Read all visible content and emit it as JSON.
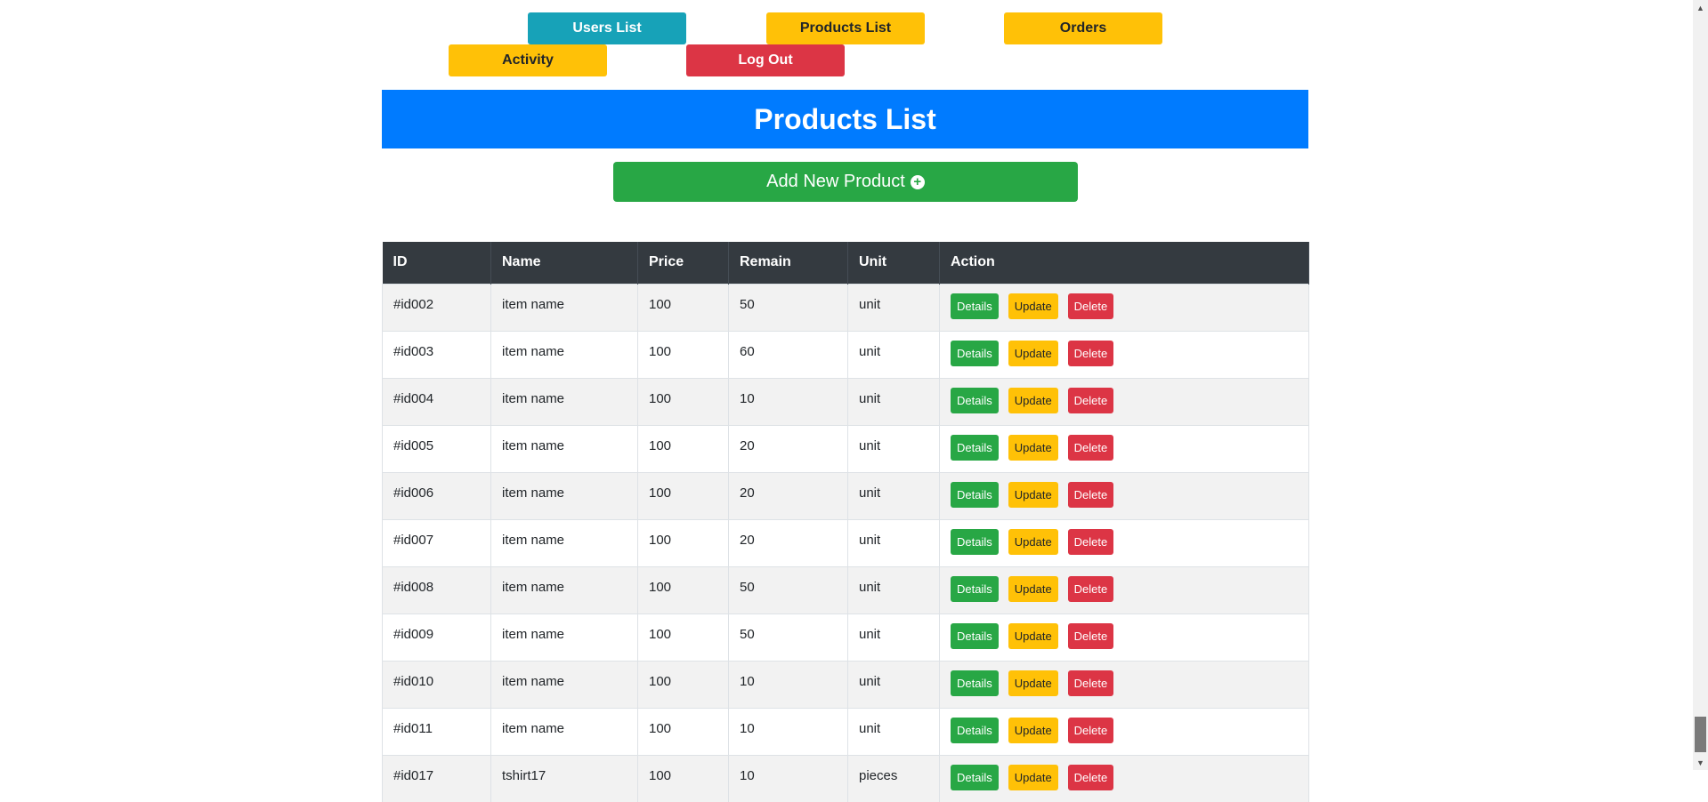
{
  "nav": {
    "users_list": "Users List",
    "products_list": "Products List",
    "orders": "Orders",
    "activity": "Activity",
    "log_out": "Log Out"
  },
  "header": {
    "title": "Products List"
  },
  "add_button": {
    "label": "Add New Product",
    "icon": "plus-circle-icon"
  },
  "table": {
    "headers": [
      "ID",
      "Name",
      "Price",
      "Remain",
      "Unit",
      "Action"
    ],
    "action_labels": {
      "details": "Details",
      "update": "Update",
      "delete": "Delete"
    },
    "rows": [
      {
        "id": "#id002",
        "name": "item name",
        "price": "100",
        "remain": "50",
        "unit": "unit"
      },
      {
        "id": "#id003",
        "name": "item name",
        "price": "100",
        "remain": "60",
        "unit": "unit"
      },
      {
        "id": "#id004",
        "name": "item name",
        "price": "100",
        "remain": "10",
        "unit": "unit"
      },
      {
        "id": "#id005",
        "name": "item name",
        "price": "100",
        "remain": "20",
        "unit": "unit"
      },
      {
        "id": "#id006",
        "name": "item name",
        "price": "100",
        "remain": "20",
        "unit": "unit"
      },
      {
        "id": "#id007",
        "name": "item name",
        "price": "100",
        "remain": "20",
        "unit": "unit"
      },
      {
        "id": "#id008",
        "name": "item name",
        "price": "100",
        "remain": "50",
        "unit": "unit"
      },
      {
        "id": "#id009",
        "name": "item name",
        "price": "100",
        "remain": "50",
        "unit": "unit"
      },
      {
        "id": "#id010",
        "name": "item name",
        "price": "100",
        "remain": "10",
        "unit": "unit"
      },
      {
        "id": "#id011",
        "name": "item name",
        "price": "100",
        "remain": "10",
        "unit": "unit"
      },
      {
        "id": "#id017",
        "name": "tshirt17",
        "price": "100",
        "remain": "10",
        "unit": "pieces"
      }
    ]
  },
  "colors": {
    "primary": "#007bff",
    "success": "#28a745",
    "warning": "#ffc107",
    "danger": "#dc3545",
    "info": "#17a2b8",
    "dark": "#343a40"
  }
}
